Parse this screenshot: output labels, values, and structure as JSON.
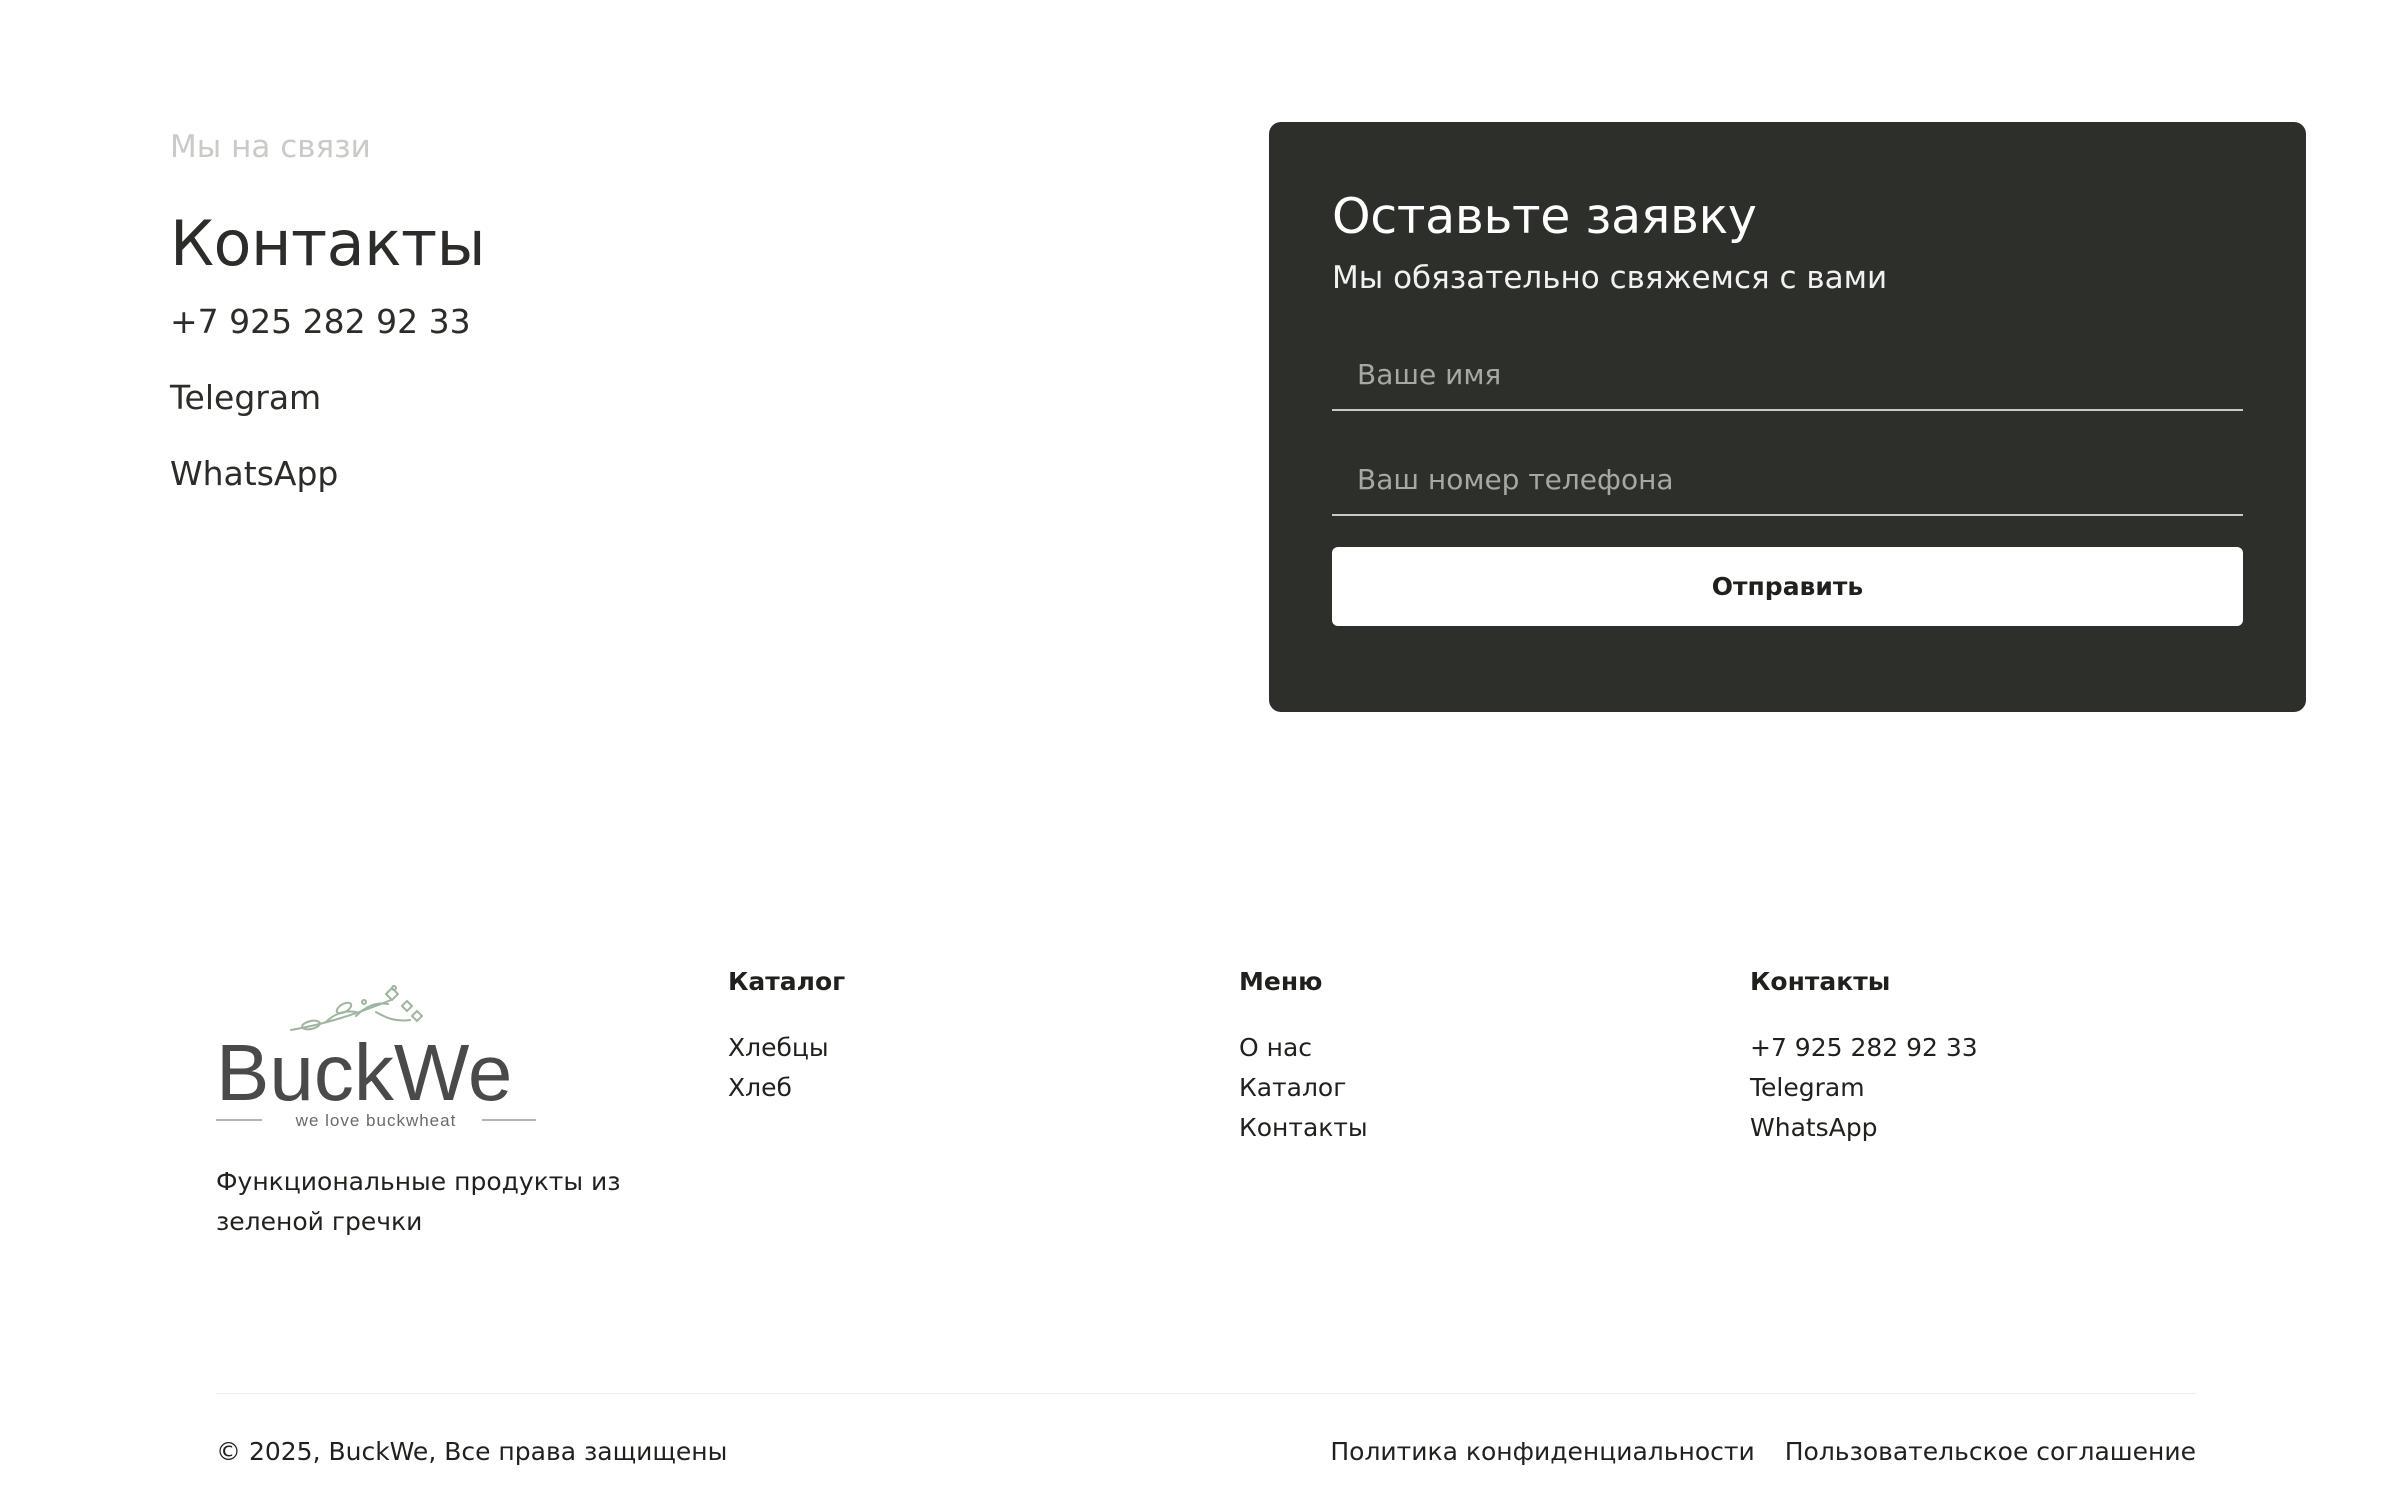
{
  "contacts_section": {
    "eyebrow": "Мы на связи",
    "title": "Контакты",
    "phone": "+7 925 282 92 33",
    "telegram": "Telegram",
    "whatsapp": "WhatsApp"
  },
  "form": {
    "title": "Оставьте заявку",
    "subtitle": "Мы обязательно свяжемся с вами",
    "name_placeholder": "Ваше имя",
    "name_value": "",
    "phone_placeholder": "Ваш номер телефона",
    "phone_value": "",
    "submit_label": "Отправить"
  },
  "footer": {
    "logo": {
      "brand": "BuckWe",
      "slogan": "we love buckwheat"
    },
    "tagline": "Функциональные продукты из зеленой гречки",
    "columns": [
      {
        "title": "Каталог",
        "items": [
          "Хлебцы",
          "Хлеб"
        ]
      },
      {
        "title": "Меню",
        "items": [
          "О нас",
          "Каталог",
          "Контакты"
        ]
      },
      {
        "title": "Контакты",
        "items": [
          "+7 925 282 92 33",
          "Telegram",
          "WhatsApp"
        ]
      }
    ],
    "copyright": "© 2025, BuckWe, Все права защищены",
    "legal": {
      "privacy": "Политика конфиденциальности",
      "terms": "Пользовательское соглашение"
    }
  },
  "colors": {
    "form_background": "#2c2f2a",
    "text_dark": "#2b2d28",
    "eyebrow": "#c9cbc6",
    "logo_leaf": "#9fb59f"
  }
}
